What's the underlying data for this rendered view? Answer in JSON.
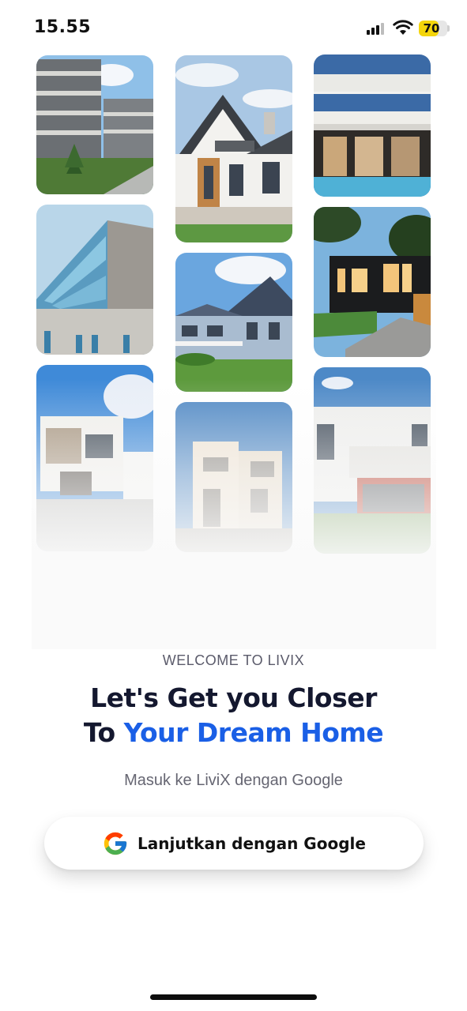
{
  "status_bar": {
    "time": "15.55",
    "battery_level": "70",
    "battery_fraction": 0.7,
    "battery_color": "#f4d50a"
  },
  "gallery": {
    "images": [
      {
        "name": "gallery-image-apartment-complex",
        "subject": "modern apartment complex"
      },
      {
        "name": "gallery-image-gabled-house",
        "subject": "white gabled house with balcony"
      },
      {
        "name": "gallery-image-villa-pool",
        "subject": "modern white villa with pool"
      },
      {
        "name": "gallery-image-glass-facade",
        "subject": "glass facade building"
      },
      {
        "name": "gallery-image-suburban-house",
        "subject": "blue suburban house"
      },
      {
        "name": "gallery-image-black-modern-house",
        "subject": "black modern house at dusk"
      },
      {
        "name": "gallery-image-white-house-gray",
        "subject": "white and gray modern house"
      },
      {
        "name": "gallery-image-beige-house",
        "subject": "beige townhouse"
      },
      {
        "name": "gallery-image-white-house-porch",
        "subject": "white house with red porch"
      }
    ]
  },
  "welcome": {
    "eyebrow": "WELCOME TO LIVIX",
    "headline_line1": "Let's Get you Closer",
    "headline_line2_prefix": "To ",
    "headline_line2_accent": "Your Dream Home",
    "subtitle": "Masuk ke LiviX dengan Google"
  },
  "google_button": {
    "label": "Lanjutkan dengan Google",
    "icon": "google-icon"
  },
  "colors": {
    "accent": "#1a5fe6",
    "headline": "#14182f"
  }
}
